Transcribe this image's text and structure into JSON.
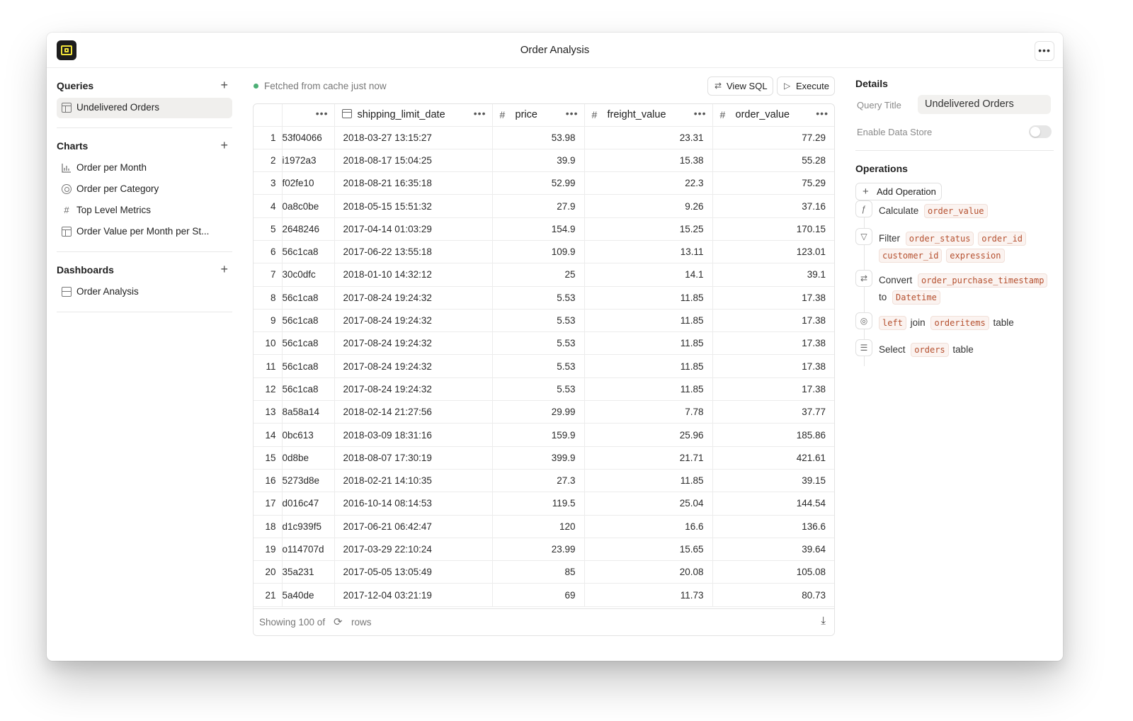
{
  "window": {
    "title": "Order Analysis",
    "menu_icon": "more-horizontal-icon"
  },
  "sidebar": {
    "queries": {
      "title": "Queries",
      "items": [
        {
          "label": "Undelivered Orders",
          "icon": "table-icon"
        }
      ]
    },
    "charts": {
      "title": "Charts",
      "items": [
        {
          "label": "Order per Month",
          "icon": "bar-chart-icon"
        },
        {
          "label": "Order per Category",
          "icon": "pie-chart-icon"
        },
        {
          "label": "Top Level Metrics",
          "icon": "hash-icon"
        },
        {
          "label": "Order Value per Month per St...",
          "icon": "table-icon"
        }
      ]
    },
    "dashboards": {
      "title": "Dashboards",
      "items": [
        {
          "label": "Order Analysis",
          "icon": "dashboard-icon"
        }
      ]
    }
  },
  "status": {
    "text": "Fetched from cache just now",
    "color": "#4caf75"
  },
  "toolbar": {
    "view_sql_label": "View SQL",
    "execute_label": "Execute"
  },
  "table": {
    "columns": [
      {
        "name": "",
        "type": "text"
      },
      {
        "name": "shipping_limit_date",
        "type": "datetime"
      },
      {
        "name": "price",
        "type": "number"
      },
      {
        "name": "freight_value",
        "type": "number"
      },
      {
        "name": "order_value",
        "type": "number"
      }
    ],
    "rows": [
      [
        "1",
        "53f04066",
        "2018-03-27 13:15:27",
        "53.98",
        "23.31",
        "77.29"
      ],
      [
        "2",
        "i1972a3",
        "2018-08-17 15:04:25",
        "39.9",
        "15.38",
        "55.28"
      ],
      [
        "3",
        "f02fe10",
        "2018-08-21 16:35:18",
        "52.99",
        "22.3",
        "75.29"
      ],
      [
        "4",
        "0a8c0be",
        "2018-05-15 15:51:32",
        "27.9",
        "9.26",
        "37.16"
      ],
      [
        "5",
        "2648246",
        "2017-04-14 01:03:29",
        "154.9",
        "15.25",
        "170.15"
      ],
      [
        "6",
        "56c1ca8",
        "2017-06-22 13:55:18",
        "109.9",
        "13.11",
        "123.01"
      ],
      [
        "7",
        "30c0dfc",
        "2018-01-10 14:32:12",
        "25",
        "14.1",
        "39.1"
      ],
      [
        "8",
        "56c1ca8",
        "2017-08-24 19:24:32",
        "5.53",
        "11.85",
        "17.38"
      ],
      [
        "9",
        "56c1ca8",
        "2017-08-24 19:24:32",
        "5.53",
        "11.85",
        "17.38"
      ],
      [
        "10",
        "56c1ca8",
        "2017-08-24 19:24:32",
        "5.53",
        "11.85",
        "17.38"
      ],
      [
        "11",
        "56c1ca8",
        "2017-08-24 19:24:32",
        "5.53",
        "11.85",
        "17.38"
      ],
      [
        "12",
        "56c1ca8",
        "2017-08-24 19:24:32",
        "5.53",
        "11.85",
        "17.38"
      ],
      [
        "13",
        "8a58a14",
        "2018-02-14 21:27:56",
        "29.99",
        "7.78",
        "37.77"
      ],
      [
        "14",
        "0bc613",
        "2018-03-09 18:31:16",
        "159.9",
        "25.96",
        "185.86"
      ],
      [
        "15",
        "0d8be",
        "2018-08-07 17:30:19",
        "399.9",
        "21.71",
        "421.61"
      ],
      [
        "16",
        "5273d8e",
        "2018-02-21 14:10:35",
        "27.3",
        "11.85",
        "39.15"
      ],
      [
        "17",
        "d016c47",
        "2016-10-14 08:14:53",
        "119.5",
        "25.04",
        "144.54"
      ],
      [
        "18",
        "d1c939f5",
        "2017-06-21 06:42:47",
        "120",
        "16.6",
        "136.6"
      ],
      [
        "19",
        "o114707d",
        "2017-03-29 22:10:24",
        "23.99",
        "15.65",
        "39.64"
      ],
      [
        "20",
        "35a231",
        "2017-05-05 13:05:49",
        "85",
        "20.08",
        "105.08"
      ],
      [
        "21",
        "5a40de",
        "2017-12-04 03:21:19",
        "69",
        "11.73",
        "80.73"
      ]
    ]
  },
  "footer": {
    "showing_text": "Showing 100 of",
    "rows_text": "rows"
  },
  "details": {
    "title": "Details",
    "query_title_label": "Query Title",
    "query_title_value": "Undelivered Orders",
    "enable_data_store_label": "Enable Data Store",
    "enable_data_store": false
  },
  "operations": {
    "title": "Operations",
    "add_label": "Add Operation",
    "items": [
      {
        "icon": "function-icon",
        "parts": [
          {
            "t": "Calculate"
          },
          {
            "c": "order_value"
          }
        ]
      },
      {
        "icon": "filter-icon",
        "parts": [
          {
            "t": "Filter"
          },
          {
            "c": "order_status"
          },
          {
            "c": "order_id"
          },
          {
            "c": "customer_id"
          },
          {
            "c": "expression"
          }
        ]
      },
      {
        "icon": "convert-icon",
        "parts": [
          {
            "t": "Convert"
          },
          {
            "c": "order_purchase_timestamp"
          },
          {
            "t": "to"
          },
          {
            "c": "Datetime"
          }
        ]
      },
      {
        "icon": "join-icon",
        "parts": [
          {
            "c": "left"
          },
          {
            "t": "join"
          },
          {
            "c": "orderitems"
          },
          {
            "t": "table"
          }
        ]
      },
      {
        "icon": "database-icon",
        "parts": [
          {
            "t": "Select"
          },
          {
            "c": "orders"
          },
          {
            "t": "table"
          }
        ]
      }
    ]
  }
}
